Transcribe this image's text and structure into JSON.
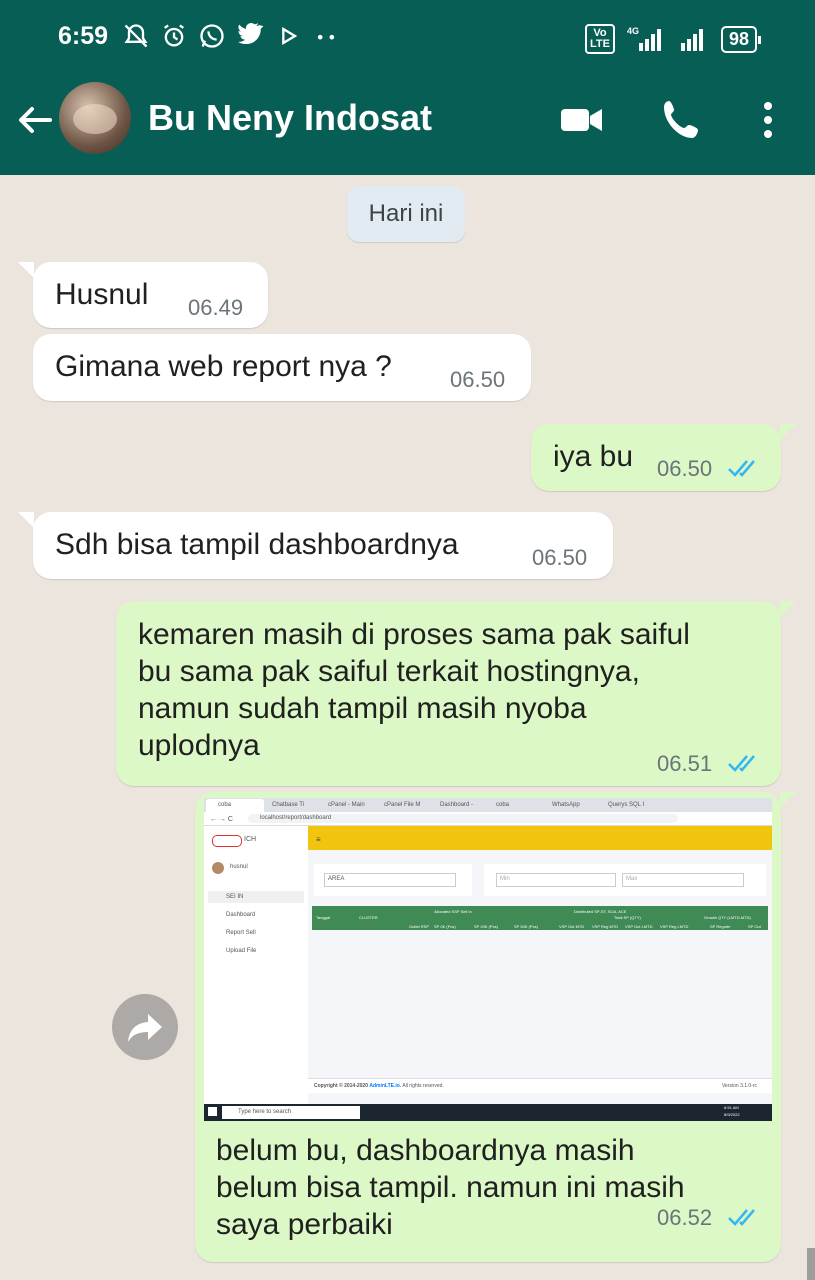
{
  "status_bar": {
    "time": "6:59",
    "network": "4G",
    "volte_line1": "Vo",
    "volte_line2": "LTE",
    "battery": "98"
  },
  "header": {
    "contact_name": "Bu Neny Indosat"
  },
  "date_chip": "Hari ini",
  "messages": [
    {
      "text": "Husnul",
      "time": "06.49",
      "direction": "in"
    },
    {
      "text": "Gimana web report nya ?",
      "time": "06.50",
      "direction": "in"
    },
    {
      "text": "iya bu",
      "time": "06.50",
      "direction": "out",
      "status": "read"
    },
    {
      "text": "Sdh bisa tampil dashboardnya",
      "time": "06.50",
      "direction": "in"
    },
    {
      "text": "kemaren masih di proses sama pak saiful\nbu sama pak saiful terkait hostingnya,\nnamun sudah tampil masih nyoba\nuplodnya",
      "time": "06.51",
      "direction": "out",
      "status": "read"
    },
    {
      "text": "belum bu, dashboardnya masih\nbelum bisa tampil. namun ini masih\nsaya perbaiki",
      "time": "06.52",
      "direction": "out",
      "status": "read"
    }
  ],
  "screenshot": {
    "browser_tabs": [
      "coba",
      "Chatbase Ti",
      "cPanel - Main",
      "cPanel File M",
      "Dashboard -",
      "coba",
      "WhatsApp",
      "Querys SQL I"
    ],
    "url": "localhost/report/dashboard",
    "brand": "ICH",
    "user": "husnul",
    "menu_select": "SEI IN",
    "menu": [
      "Dashboard",
      "Report Sell",
      "Upload File"
    ],
    "area_select": "AREA",
    "min_placeholder": "Min",
    "max_placeholder": "Max",
    "table_headers": [
      "Tanggal",
      "CLUSTER",
      "Allocated SSP Sell In",
      "Distributed SP-ST, SOA, ACE",
      "Total SP (QTY)",
      "Growth QTY (LMTD-MTD)"
    ],
    "table_subheaders": [
      "Outlet RSP",
      "SP 0K (Pcs)",
      "SP 20K (Pcs)",
      "SP 50K (Pcs)",
      "VSP Out MTD",
      "VSP Reg MTD",
      "VSP Out LMTD",
      "VSP Reg LMTD",
      "SP Reguler",
      "SP Out"
    ],
    "footer_copyright": "Copyright © 2014-2020",
    "footer_link": "AdminLTE.io.",
    "footer_rights": "All rights reserved.",
    "footer_version": "Version 3.1.0-rc",
    "taskbar_search": "Type here to search",
    "taskbar_time": "6:51 AM",
    "taskbar_date": "8/9/2022"
  },
  "colors": {
    "header": "#075e54",
    "incoming": "#ffffff",
    "outgoing": "#dcf8c6",
    "read_ticks": "#34b7f1",
    "dashboard_topbar": "#f1c40f",
    "dashboard_table_header": "#3f8a55"
  }
}
